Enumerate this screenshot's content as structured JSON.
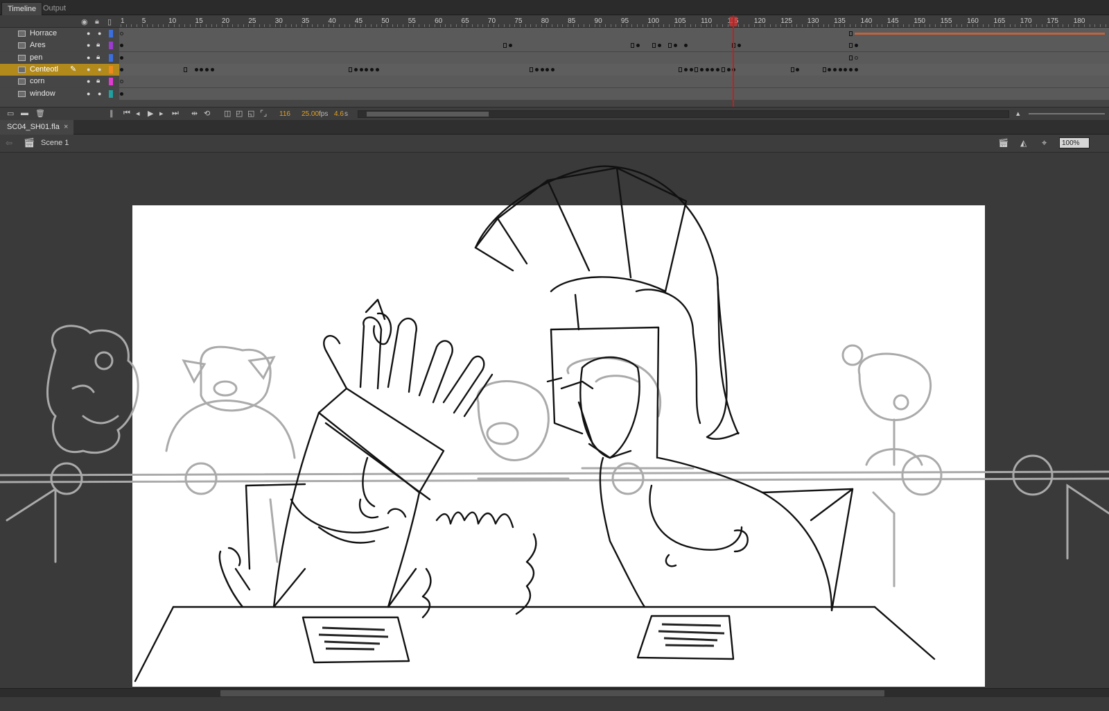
{
  "panel_tabs": [
    {
      "label": "Timeline",
      "active": true
    },
    {
      "label": "Output",
      "active": false
    }
  ],
  "ruler": {
    "ticks": [
      "1",
      "5",
      "10",
      "15",
      "20",
      "25",
      "30",
      "35",
      "40",
      "45",
      "50",
      "55",
      "60",
      "65",
      "70",
      "75",
      "80",
      "85",
      "90",
      "95",
      "100",
      "105",
      "110",
      "115",
      "120",
      "125",
      "130",
      "135",
      "140",
      "145",
      "150",
      "155",
      "160",
      "165",
      "170",
      "175",
      "180"
    ]
  },
  "layers": [
    {
      "name": "Horrace",
      "color": "#3b6fe0",
      "locked": false,
      "selected": false
    },
    {
      "name": "Ares",
      "color": "#9b3bd0",
      "locked": true,
      "selected": false
    },
    {
      "name": "pen",
      "color": "#3b6fe0",
      "locked": true,
      "selected": false
    },
    {
      "name": "Centeotl",
      "color": "#f08a1c",
      "locked": false,
      "selected": true
    },
    {
      "name": "corn",
      "color": "#e03bd0",
      "locked": true,
      "selected": false
    },
    {
      "name": "window",
      "color": "#20a0a0",
      "locked": false,
      "selected": false
    }
  ],
  "toolbar": {
    "current_frame": "116",
    "fps_value": "25.00",
    "fps_unit": "fps",
    "time_value": "4.6",
    "time_unit": "s"
  },
  "document": {
    "tab_label": "SC04_SH01.fla",
    "close_glyph": "×",
    "scene": "Scene 1",
    "zoom": "100%"
  },
  "icons": {
    "eye": "eye-icon",
    "lock": "lock-icon",
    "outline": "outline-icon",
    "back": "back-arrow-icon",
    "scene": "clapper-icon"
  }
}
